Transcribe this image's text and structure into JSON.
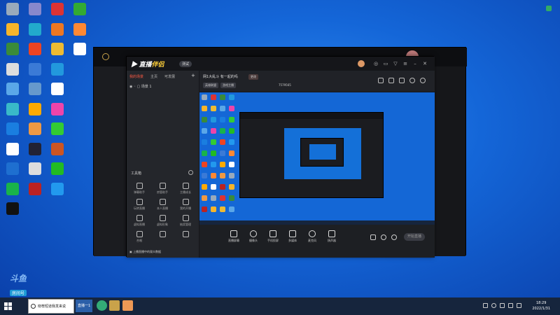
{
  "desktop": {
    "icons": [
      {
        "label": "",
        "color": "#9ab"
      },
      {
        "label": "",
        "color": "#f7b52a"
      },
      {
        "label": "",
        "color": "#3a8b3a"
      },
      {
        "label": "",
        "color": "#ddd"
      },
      {
        "label": "",
        "color": "#5aa7e8"
      },
      {
        "label": "",
        "color": "#39b9c8"
      },
      {
        "label": "",
        "color": "#1a7ee0"
      },
      {
        "label": "",
        "color": "#fff"
      },
      {
        "label": "",
        "color": "#1e6fd0"
      },
      {
        "label": "",
        "color": "#19b34a"
      },
      {
        "label": "",
        "color": "#111"
      },
      {
        "label": "",
        "color": "#88c"
      },
      {
        "label": "",
        "color": "#2ac"
      },
      {
        "label": "",
        "color": "#e42"
      },
      {
        "label": "",
        "color": "#3b7ad6"
      },
      {
        "label": "",
        "color": "#69c"
      },
      {
        "label": "",
        "color": "#fa0"
      },
      {
        "label": "",
        "color": "#e94"
      },
      {
        "label": "",
        "color": "#223"
      },
      {
        "label": "",
        "color": "#ddd"
      },
      {
        "label": "",
        "color": "#b22"
      },
      {
        "label": "",
        "color": "#d33"
      },
      {
        "label": "",
        "color": "#e72"
      },
      {
        "label": "",
        "color": "#eb3"
      },
      {
        "label": "",
        "color": "#29d"
      },
      {
        "label": "",
        "color": "#fff"
      },
      {
        "label": "",
        "color": "#e4a"
      },
      {
        "label": "",
        "color": "#3c3"
      },
      {
        "label": "",
        "color": "#c52"
      },
      {
        "label": "",
        "color": "#2b2"
      },
      {
        "label": "",
        "color": "#29e"
      },
      {
        "label": "",
        "color": "#3a3"
      },
      {
        "label": "",
        "color": "#f83"
      },
      {
        "label": "",
        "color": "#fff"
      }
    ]
  },
  "app": {
    "logo_prefix": "直播",
    "logo_suffix": "伴侣",
    "version": "测试",
    "tabs": [
      "我的场景",
      "主页",
      "可发展"
    ],
    "scene": "场景 1",
    "tools_label": "工具箱",
    "tools": [
      "弹幕助手",
      "房管助手",
      "主播成长",
      "玩转直播",
      "本人直播",
      "我的开播",
      "虚拟直播",
      "虚拟形象",
      "抽奖管理",
      "合唱",
      "",
      ""
    ],
    "bottom_hint": "上播直播中的观众数据",
    "room_title": "网1大乱斗 有一起的吗",
    "room_badge": "更改",
    "tags": [
      "英雄联盟",
      "游戏主播",
      "7579565"
    ],
    "controls": [
      "直播屏幕",
      "摄像头",
      "手机投屏",
      "多媒体",
      "麦克风",
      "扬声器"
    ],
    "start_label": "开始直播"
  },
  "taskbar": {
    "search_text": "晓荐短道我发来说",
    "active_btn": "直播一1",
    "time": "18:29",
    "date": "2022/1/31"
  },
  "watermark": {
    "main": "斗鱼",
    "tag": "房间号",
    "room": "7579565"
  },
  "colors": {
    "accent": "#ff5a44",
    "desktop_blue": "#1466d8",
    "taskbar": "#16253d"
  }
}
